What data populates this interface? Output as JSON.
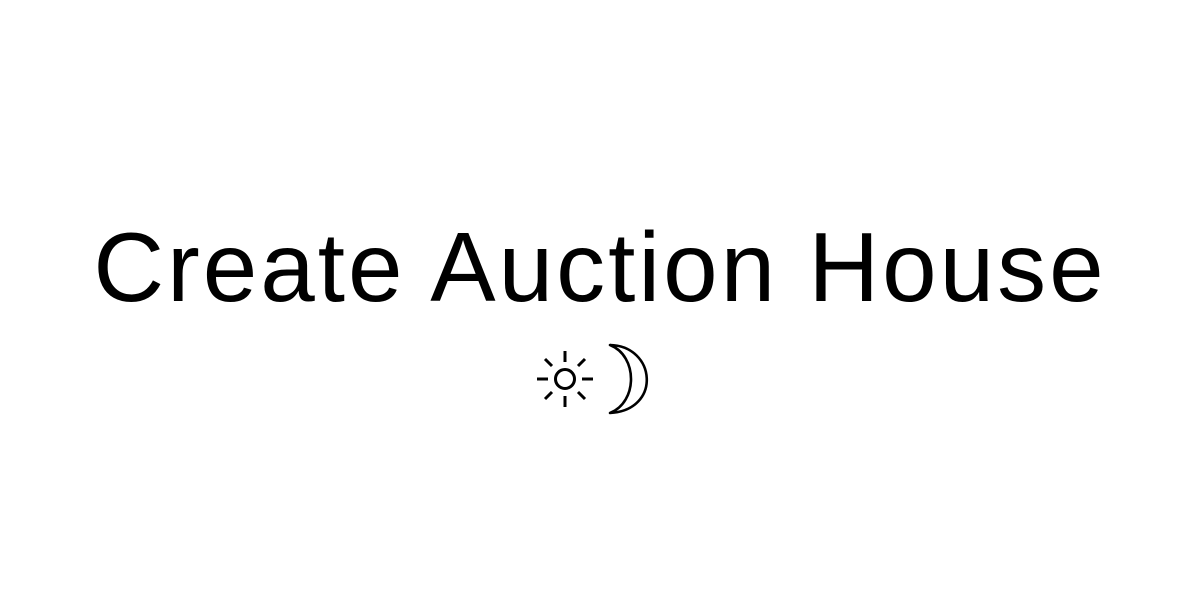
{
  "page": {
    "title": "Create Auction House"
  },
  "theme_toggle": {
    "icons": [
      "sun-icon",
      "moon-icon"
    ],
    "color": "#000000"
  },
  "colors": {
    "background": "#ffffff",
    "text": "#000000"
  }
}
